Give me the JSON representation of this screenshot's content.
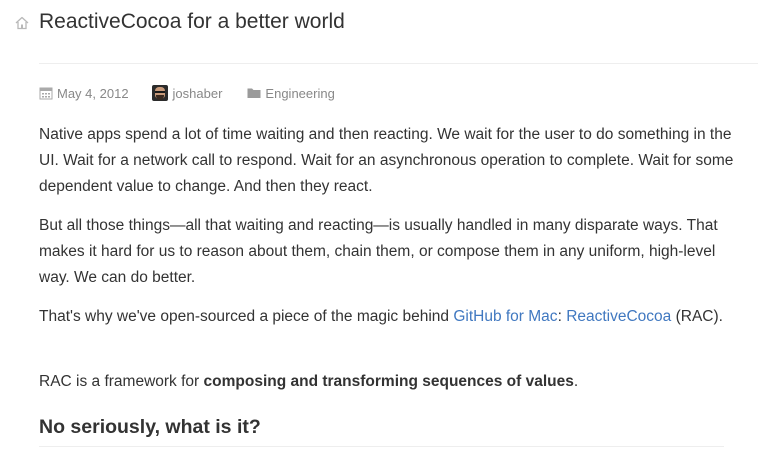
{
  "post": {
    "title": "ReactiveCocoa for a better world",
    "meta": {
      "date": "May 4, 2012",
      "author": "joshaber",
      "category": "Engineering"
    }
  },
  "content": {
    "p1": "Native apps spend a lot of time waiting and then reacting. We wait for the user to do something in the UI. Wait for a network call to respond. Wait for an asynchronous operation to complete. Wait for some dependent value to change. And then they react.",
    "p2": "But all those things—all that waiting and reacting—is usually handled in many disparate ways. That makes it hard for us to reason about them, chain them, or compose them in any uniform, high-level way. We can do better.",
    "p3": {
      "before": "That's why we've open-sourced a piece of the magic behind ",
      "link1": "GitHub for Mac",
      "middle": ": ",
      "link2": "ReactiveCocoa",
      "after": " (RAC)."
    },
    "p4": {
      "before": "RAC is a framework for ",
      "strong": "composing and transforming sequences of values",
      "after": "."
    },
    "heading": "No seriously, what is it?"
  },
  "icons": {
    "home": "home-icon",
    "date": "calendar-icon",
    "author": "avatar",
    "category": "folder-icon"
  },
  "colors": {
    "text": "#333333",
    "meta": "#888888",
    "link": "#4078c0",
    "rule": "#eeeeee"
  }
}
